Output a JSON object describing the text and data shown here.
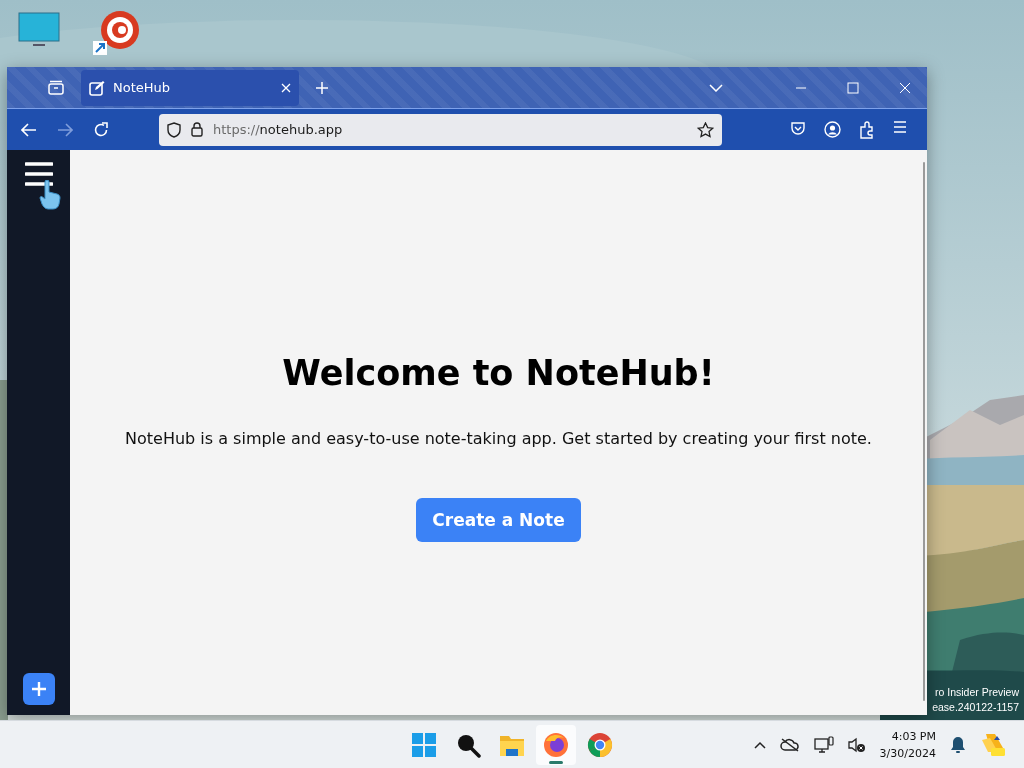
{
  "browser": {
    "tabs": [
      {
        "label": "NoteHub",
        "selected": true
      }
    ],
    "address": {
      "scheme": "https://",
      "host": "notehub.app"
    }
  },
  "app": {
    "heading": "Welcome to NoteHub!",
    "description": "NoteHub is a simple and easy-to-use note-taking app. Get started by creating your first note.",
    "button": "Create a Note"
  },
  "watermark_lines": [
    "ro Insider Preview",
    "ease.240122-1157"
  ],
  "taskbar": {
    "apps": [
      {
        "kind": "start",
        "selected": false
      },
      {
        "kind": "search",
        "selected": false
      },
      {
        "kind": "files",
        "selected": false
      },
      {
        "kind": "firefox",
        "selected": true
      },
      {
        "kind": "chrome",
        "selected": false
      }
    ],
    "time": "4:03 PM",
    "date": "3/30/2024"
  }
}
